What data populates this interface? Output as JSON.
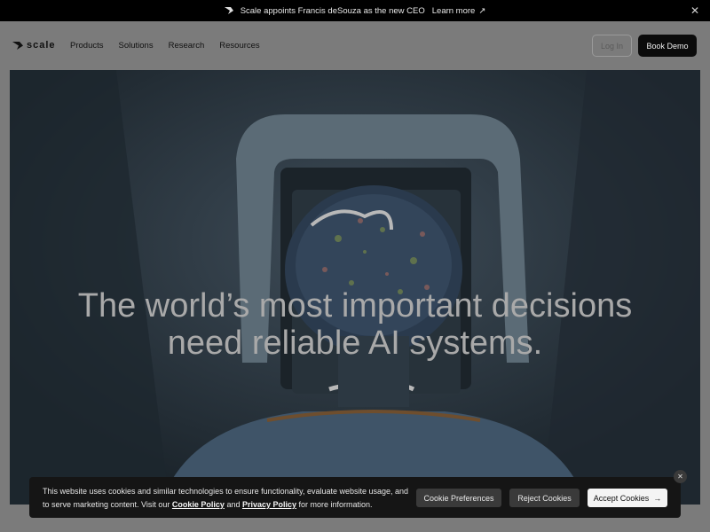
{
  "announcement": {
    "text": "Scale appoints Francis deSouza as the new CEO",
    "link_label": "Learn more",
    "link_icon": "arrow-up-right-icon",
    "close_icon": "close-icon"
  },
  "nav": {
    "brand": "scale",
    "links": [
      "Products",
      "Solutions",
      "Research",
      "Resources"
    ],
    "login_label": "Log In",
    "demo_label": "Book Demo"
  },
  "hero": {
    "title_line1": "The world’s most important decisions",
    "title_line2": "need reliable AI systems."
  },
  "cookie_banner": {
    "text_before": "This website uses cookies and similar technologies to ensure functionality, evaluate website usage, and to serve marketing content. Visit our ",
    "cookie_policy": "Cookie Policy",
    "and": " and ",
    "privacy_policy": "Privacy Policy",
    "text_after": " for more information.",
    "preferences_label": "Cookie Preferences",
    "reject_label": "Reject Cookies",
    "accept_label": "Accept Cookies",
    "accept_icon": "arrow-right-icon",
    "close_icon": "close-icon"
  },
  "colors": {
    "announce_bg": "#000000",
    "overlay": "#7b7b7b",
    "demo_button": "#0b0b0b",
    "cookie_bg": "#151515",
    "accept_bg": "#f4f4f4"
  }
}
